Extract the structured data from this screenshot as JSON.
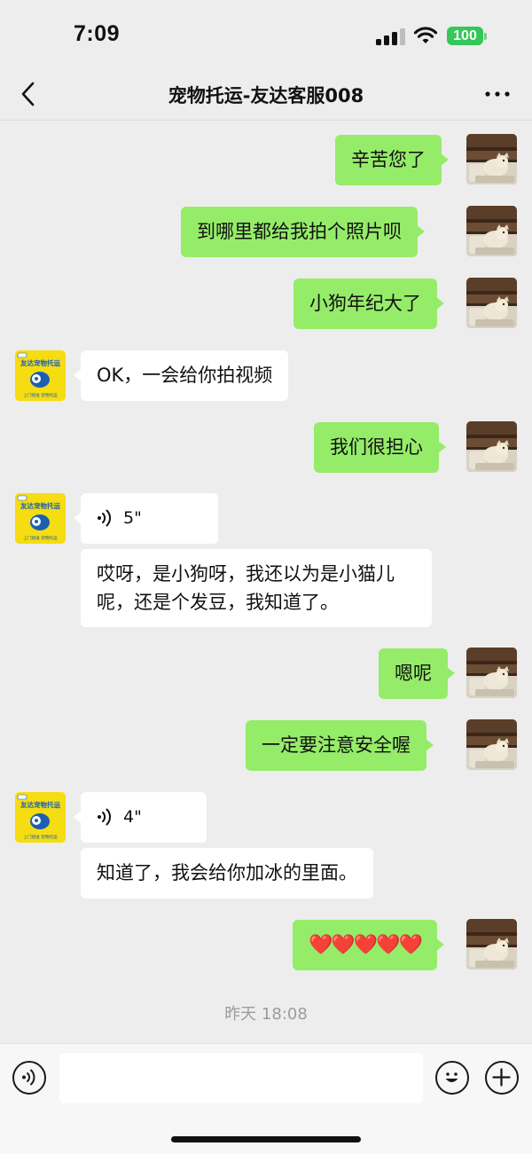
{
  "status_bar": {
    "time": "7:09",
    "battery": "100",
    "icons": [
      "signal-icon",
      "wifi-icon",
      "battery-icon"
    ]
  },
  "nav": {
    "title": "宠物托运-友达客服008",
    "back_icon": "chevron-left-icon",
    "more_icon": "more-dots-icon"
  },
  "avatar_logo": {
    "line1": "友达宠物托运",
    "line2": "上门接送  宠物托运"
  },
  "messages": [
    {
      "sender": "self",
      "text": "辛苦您了"
    },
    {
      "sender": "self",
      "text": "到哪里都给我拍个照片呗"
    },
    {
      "sender": "self",
      "text": "小狗年纪大了"
    },
    {
      "sender": "other",
      "text": "OK，一会给你拍视频"
    },
    {
      "sender": "self",
      "text": "我们很担心"
    },
    {
      "sender": "other",
      "type": "voice",
      "duration": "5\""
    },
    {
      "sender": "other",
      "type": "transcript",
      "text": "哎呀，是小狗呀，我还以为是小猫儿呢，还是个发豆，我知道了。"
    },
    {
      "sender": "self",
      "text": "嗯呢"
    },
    {
      "sender": "self",
      "text": "一定要注意安全喔"
    },
    {
      "sender": "other",
      "type": "voice",
      "duration": "4\""
    },
    {
      "sender": "other",
      "type": "transcript",
      "text": "知道了，我会给你加冰的里面。"
    },
    {
      "sender": "self",
      "text": "❤️❤️❤️❤️❤️"
    }
  ],
  "timestamp": "昨天 18:08",
  "input_bar": {
    "voice_icon": "voice-icon",
    "emoji_icon": "emoji-icon",
    "plus_icon": "plus-icon",
    "input_value": ""
  },
  "colors": {
    "self_bubble": "#95ec69",
    "other_bubble": "#ffffff",
    "background": "#ededed",
    "logo_yellow": "#f6dd11",
    "logo_blue": "#1b5fb3"
  }
}
